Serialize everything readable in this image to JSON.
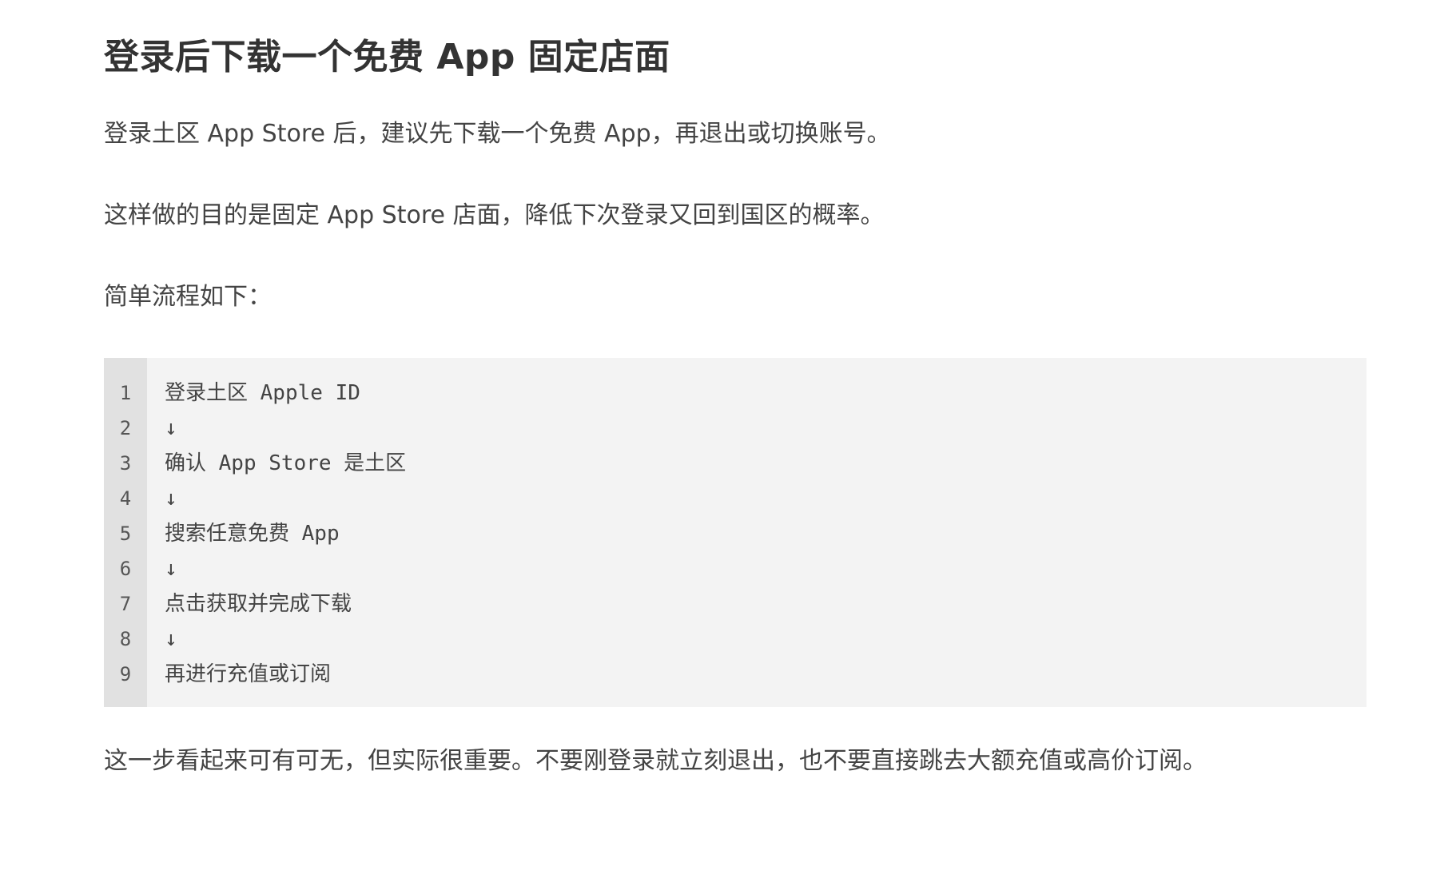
{
  "article": {
    "title": "登录后下载一个免费 App 固定店面",
    "paragraphs": [
      "登录土区 App Store 后，建议先下载一个免费 App，再退出或切换账号。",
      "这样做的目的是固定 App Store 店面，降低下次登录又回到国区的概率。",
      "简单流程如下："
    ],
    "code_block": {
      "line_numbers": [
        "1",
        "2",
        "3",
        "4",
        "5",
        "6",
        "7",
        "8",
        "9"
      ],
      "lines": [
        "登录土区 Apple ID",
        "↓",
        "确认 App Store 是土区",
        "↓",
        "搜索任意免费 App",
        "↓",
        "点击获取并完成下载",
        "↓",
        "再进行充值或订阅"
      ]
    },
    "closing": "这一步看起来可有可无，但实际很重要。不要刚登录就立刻退出，也不要直接跳去大额充值或高价订阅。"
  }
}
